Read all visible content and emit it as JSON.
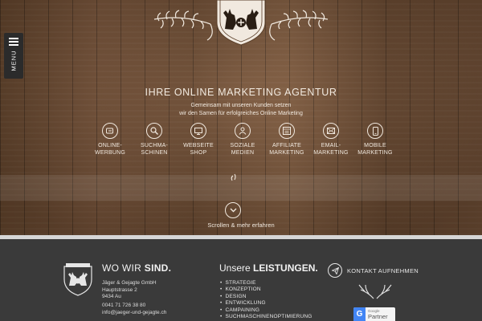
{
  "menu": {
    "label": "MENU"
  },
  "hero": {
    "headline": "IHRE ONLINE MARKETING AGENTUR",
    "subline1": "Gemeinsam mit unseren Kunden setzen",
    "subline2": "wir den Samen für erfolgreiches Online Marketing",
    "scroll_label": "Scrollen & mehr erfahren",
    "services": [
      {
        "icon": "megaphone-icon",
        "line1": "ONLINE-",
        "line2": "WERBUNG"
      },
      {
        "icon": "magnifier-icon",
        "line1": "SUCHMA-",
        "line2": "SCHINEN"
      },
      {
        "icon": "monitor-icon",
        "line1": "WEBSEITE",
        "line2": "SHOP"
      },
      {
        "icon": "people-icon",
        "line1": "SOZIALE",
        "line2": "MEDIEN"
      },
      {
        "icon": "browser-icon",
        "line1": "AFFILIATE",
        "line2": "MARKETING"
      },
      {
        "icon": "envelope-icon",
        "line1": "EMAIL-",
        "line2": "MARKETING"
      },
      {
        "icon": "smartphone-icon",
        "line1": "MOBILE",
        "line2": "MARKETING"
      }
    ]
  },
  "footer": {
    "where_title_light": "WO WIR",
    "where_title_bold": "SIND.",
    "address": [
      "Jäger & Gejagte GmbH",
      "Hauptstrasse 2",
      "9434 Au"
    ],
    "phone": "0041 71 726 38 80",
    "email": "info@jaeger-und-gejagte.ch",
    "services_title_light": "Unsere",
    "services_title_bold": "LEISTUNGEN.",
    "services_list": [
      "STRATEGIE",
      "KONZEPTION",
      "DESIGN",
      "ENTWICKLUNG",
      "CAMPAINING",
      "SUCHMASCHINENOPTIMIERUNG"
    ],
    "contact_cta": "KONTAKT AUFNEHMEN",
    "badge_small": "Google",
    "badge_large": "Partner",
    "badge_mark": "G"
  },
  "colors": {
    "wood": "#755238",
    "cream": "#f1e9df",
    "footer_bg": "#3a3a3a",
    "divider": "#d6d6d6",
    "google_blue": "#4285f4"
  }
}
